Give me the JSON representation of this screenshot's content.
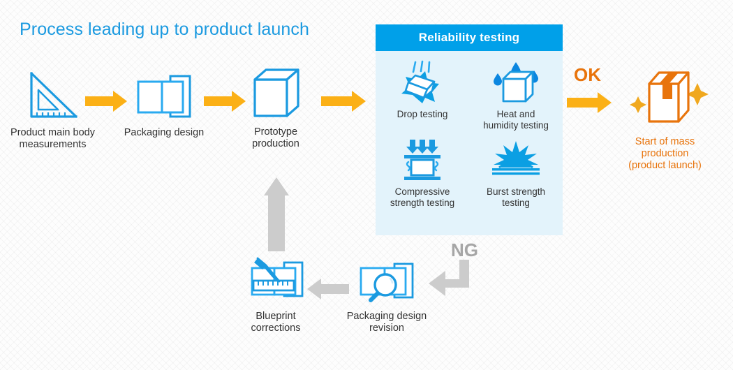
{
  "title": "Process leading up to product launch",
  "colors": {
    "blue": "#00a0e9",
    "title_blue": "#1b9ae0",
    "orange_arrow": "#fbb016",
    "orange_text": "#e8740c",
    "gray_arrow": "#cccccc",
    "panel_bg": "#e3f3fb",
    "label": "#333333"
  },
  "flow_top": [
    {
      "id": "measurements",
      "icon": "triangle-ruler-icon",
      "label": "Product main body\nmeasurements"
    },
    {
      "id": "packaging-design",
      "icon": "box-template-icon",
      "label": "Packaging design"
    },
    {
      "id": "prototype",
      "icon": "prototype-box-icon",
      "label": "Prototype\nproduction"
    }
  ],
  "panel": {
    "header": "Reliability testing",
    "tests": [
      {
        "id": "drop",
        "icon": "drop-testing-icon",
        "label": "Drop testing"
      },
      {
        "id": "heat-humidity",
        "icon": "heat-humidity-icon",
        "label": "Heat and\nhumidity testing"
      },
      {
        "id": "compressive",
        "icon": "compressive-strength-icon",
        "label": "Compressive\nstrength testing"
      },
      {
        "id": "burst",
        "icon": "burst-strength-icon",
        "label": "Burst strength\ntesting"
      }
    ]
  },
  "result_ok": {
    "badge": "OK",
    "icon": "sealed-box-icon",
    "label": "Start of mass\nproduction\n(product launch)"
  },
  "result_ng": {
    "badge": "NG"
  },
  "flow_bottom": [
    {
      "id": "design-revision",
      "icon": "magnifier-box-icon",
      "label": "Packaging design\nrevision"
    },
    {
      "id": "blueprint-corrections",
      "icon": "pencil-ruler-box-icon",
      "label": "Blueprint\ncorrections"
    }
  ],
  "arrows": {
    "forward_1": "arrow-right-orange",
    "forward_2": "arrow-right-orange",
    "forward_3": "arrow-right-orange",
    "forward_ok": "arrow-right-orange",
    "loop_back": "arrow-left-gray",
    "loop_up": "arrow-up-gray",
    "ng_elbow": "arrow-elbow-down-left-gray"
  }
}
